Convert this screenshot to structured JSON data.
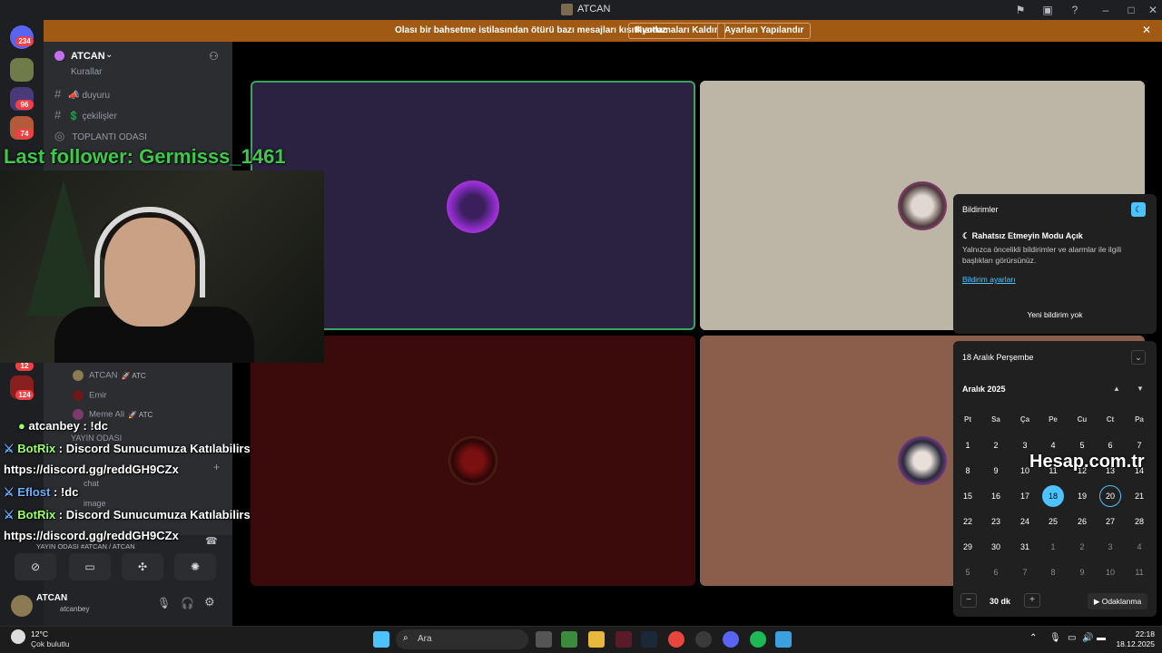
{
  "window": {
    "title": "ATCAN"
  },
  "notice": {
    "message": "Olası bir bahsetme istilasından ötürü bazı mesajları kısıtlıyoruz",
    "btn_remove": "Kısıtlamaları Kaldır",
    "btn_settings": "Ayarları Yapılandır"
  },
  "rail": {
    "badges": [
      "234",
      "96",
      "74",
      "12",
      "124"
    ]
  },
  "sidebar": {
    "server_name": "ATCAN",
    "channels": [
      {
        "label": "Kurallar"
      },
      {
        "label": "📣 duyuru"
      },
      {
        "label": "💲 çekilişler"
      },
      {
        "label": "TOPLANTI ODASI"
      }
    ],
    "voice_members": [
      {
        "name": "ATCAN",
        "tag": "🚀 ATC"
      },
      {
        "name": "Emir",
        "tag": ""
      },
      {
        "name": "Meme Ali",
        "tag": "🚀 ATC"
      }
    ],
    "voice_channel": "YAYIN ODASI",
    "text_channels": [
      "chat",
      "image"
    ],
    "voice_status": "YAYIN ODASI #ATCAN / ATCAN"
  },
  "user": {
    "name": "ATCAN",
    "status": "atcanbey"
  },
  "overlay": {
    "last_follower": "Last follower: Germisss_1461",
    "chat": [
      {
        "user": "atcanbey",
        "text": ": !dc",
        "color": "#ffffff"
      },
      {
        "user": "BotRix",
        "text": ": Discord Sunucumuza Katılabilirs",
        "color": "#9bff6a"
      },
      {
        "user": "",
        "text": "https://discord.gg/reddGH9CZx",
        "color": "#ffffff"
      },
      {
        "user": "Eflost",
        "text": ": !dc",
        "color": "#6ab0ff"
      },
      {
        "user": "BotRix",
        "text": ": Discord Sunucumuza Katılabilirs",
        "color": "#9bff6a"
      },
      {
        "user": "",
        "text": "https://discord.gg/reddGH9CZx",
        "color": "#ffffff"
      }
    ],
    "watermark": "Hesap.com.tr"
  },
  "stage": {
    "tiles": [
      {
        "name": "tile-1",
        "bg": "#2a2240"
      },
      {
        "name": "tile-2",
        "bg": "#bcb6a6"
      },
      {
        "name": "tile-3",
        "bg": "#3b0a0a"
      },
      {
        "name": "tile-4",
        "bg": "#8b5e4c"
      }
    ]
  },
  "notifications": {
    "title": "Bildirimler",
    "dnd_title": "Rahatsız Etmeyin Modu Açık",
    "dnd_desc": "Yalnızca öncelikli bildirimler ve alarmlar ile ilgili başlıkları görürsünüz.",
    "settings_link": "Bildirim ayarları",
    "empty": "Yeni bildirim yok"
  },
  "calendar": {
    "date_header": "18 Aralık Perşembe",
    "month": "Aralık 2025",
    "weekdays": [
      "Pt",
      "Sa",
      "Ça",
      "Pe",
      "Cu",
      "Ct",
      "Pa"
    ],
    "weeks": [
      [
        "1",
        "2",
        "3",
        "4",
        "5",
        "6",
        "7"
      ],
      [
        "8",
        "9",
        "10",
        "11",
        "12",
        "13",
        "14"
      ],
      [
        "15",
        "16",
        "17",
        "18",
        "19",
        "20",
        "21"
      ],
      [
        "22",
        "23",
        "24",
        "25",
        "26",
        "27",
        "28"
      ],
      [
        "29",
        "30",
        "31",
        "1",
        "2",
        "3",
        "4"
      ],
      [
        "5",
        "6",
        "7",
        "8",
        "9",
        "10",
        "11"
      ]
    ],
    "today": "18",
    "selected": "20",
    "focus_minutes": "30 dk",
    "focus_button": "Odaklanma"
  },
  "taskbar": {
    "weather_temp": "12°C",
    "weather_desc": "Çok bulutlu",
    "search_placeholder": "Ara",
    "time": "22:18",
    "date": "18.12.2025"
  },
  "colors": {
    "accent": "#4cc2ff",
    "notice_bg": "#a05a13",
    "discord_red": "#f23f43"
  }
}
